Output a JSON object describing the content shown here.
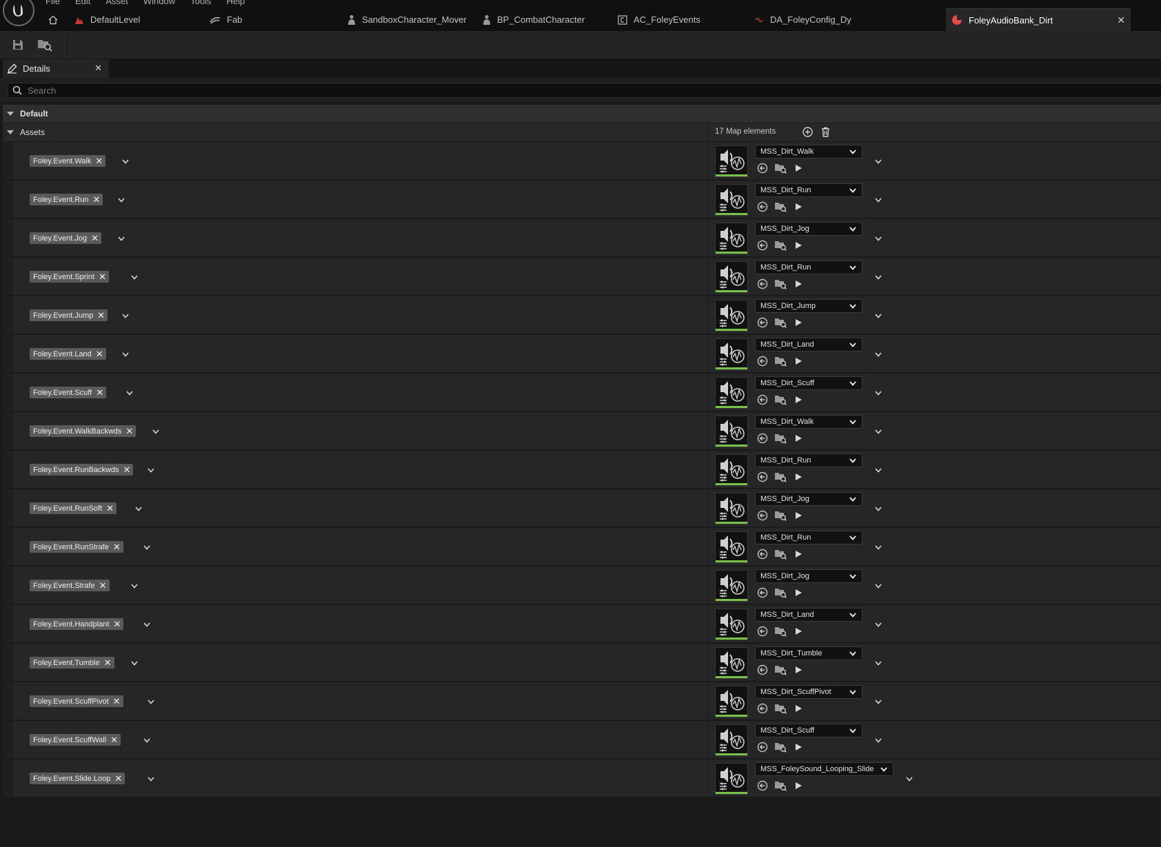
{
  "menu": [
    "File",
    "Edit",
    "Asset",
    "Window",
    "Tools",
    "Help"
  ],
  "tabs": [
    {
      "label": "DefaultLevel",
      "icon": "level-icon"
    },
    {
      "label": "Fab",
      "icon": "fab-icon"
    },
    {
      "label": "SandboxCharacter_Mover",
      "icon": "character-icon"
    },
    {
      "label": "BP_CombatCharacter",
      "icon": "character-icon"
    },
    {
      "label": "AC_FoleyEvents",
      "icon": "component-icon"
    },
    {
      "label": "DA_FoleyConfig_Dy",
      "icon": "data-asset-icon"
    },
    {
      "label": "FoleyAudioBank_Dirt",
      "icon": "audio-bank-icon",
      "active": true
    }
  ],
  "details": {
    "tab_label": "Details",
    "search_placeholder": "Search"
  },
  "categories": {
    "default": "Default",
    "assets": "Assets"
  },
  "assets_count": "17 Map elements",
  "rows": [
    {
      "key": "Foley.Event.Walk",
      "asset": "MSS_Dirt_Walk"
    },
    {
      "key": "Foley.Event.Run",
      "asset": "MSS_Dirt_Run"
    },
    {
      "key": "Foley.Event.Jog",
      "asset": "MSS_Dirt_Jog"
    },
    {
      "key": "Foley.Event.Sprint",
      "asset": "MSS_Dirt_Run"
    },
    {
      "key": "Foley.Event.Jump",
      "asset": "MSS_Dirt_Jump"
    },
    {
      "key": "Foley.Event.Land",
      "asset": "MSS_Dirt_Land"
    },
    {
      "key": "Foley.Event.Scuff",
      "asset": "MSS_Dirt_Scuff"
    },
    {
      "key": "Foley.Event.WalkBackwds",
      "asset": "MSS_Dirt_Walk"
    },
    {
      "key": "Foley.Event.RunBackwds",
      "asset": "MSS_Dirt_Run"
    },
    {
      "key": "Foley.Event.RunSoft",
      "asset": "MSS_Dirt_Jog"
    },
    {
      "key": "Foley.Event.RunStrafe",
      "asset": "MSS_Dirt_Run"
    },
    {
      "key": "Foley.Event.Strafe",
      "asset": "MSS_Dirt_Jog"
    },
    {
      "key": "Foley.Event.Handplant",
      "asset": "MSS_Dirt_Land"
    },
    {
      "key": "Foley.Event.Tumble",
      "asset": "MSS_Dirt_Tumble"
    },
    {
      "key": "Foley.Event.ScuffPivot",
      "asset": "MSS_Dirt_ScuffPivot"
    },
    {
      "key": "Foley.Event.ScuffWall",
      "asset": "MSS_Dirt_Scuff"
    },
    {
      "key": "Foley.Event.Slide.Loop",
      "asset": "MSS_FoleySound_Looping_Slide"
    }
  ],
  "colors": {
    "accent_green": "#7ac04a",
    "active_tab_icon": "#e04a4a"
  }
}
